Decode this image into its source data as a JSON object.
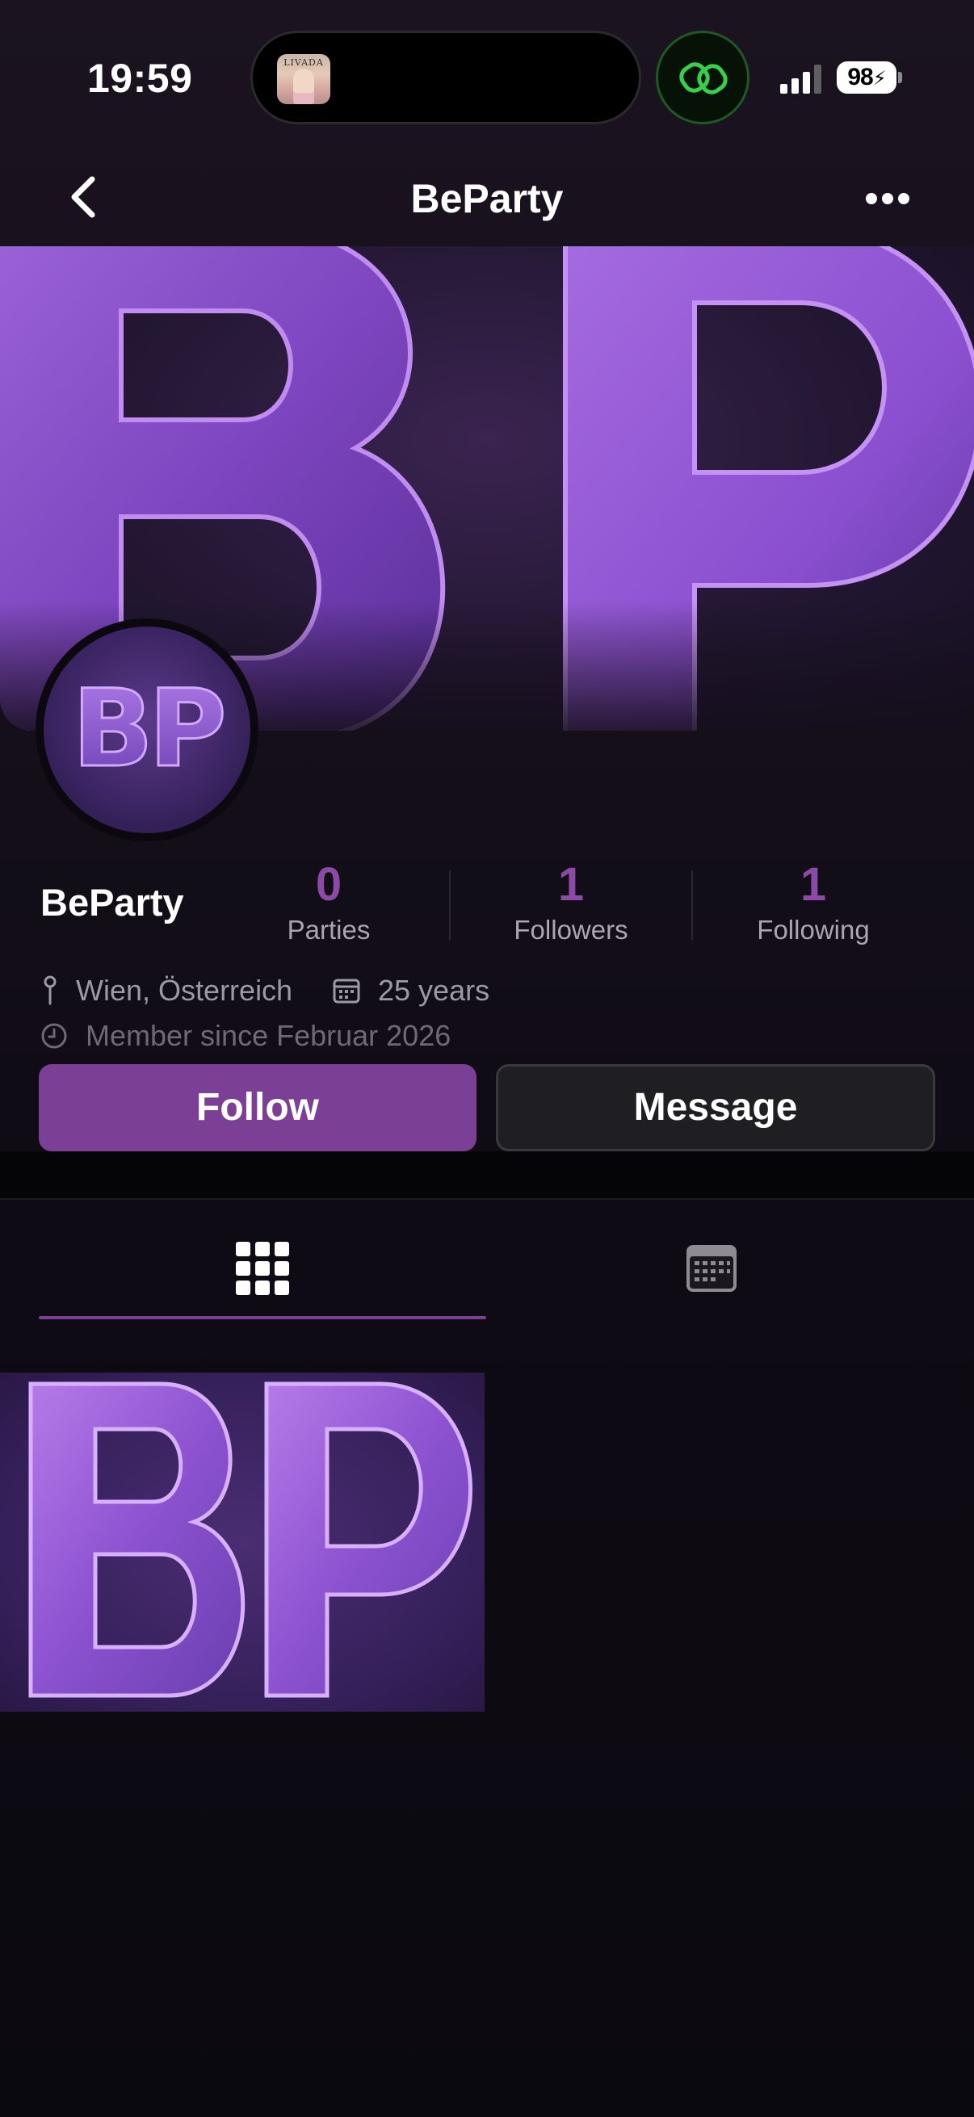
{
  "status_bar": {
    "time": "19:59",
    "island_thumbnail_text": "LIVADA",
    "battery": "98"
  },
  "nav": {
    "title": "BeParty",
    "back_icon": "chevron-left-icon",
    "more_icon": "ellipsis-icon"
  },
  "cover": {
    "logo_text": "BP"
  },
  "avatar": {
    "logo_text": "BP"
  },
  "profile": {
    "name": "BeParty",
    "stats": [
      {
        "value": "0",
        "label": "Parties"
      },
      {
        "value": "1",
        "label": "Followers"
      },
      {
        "value": "1",
        "label": "Following"
      }
    ],
    "location": "Wien, Österreich",
    "age": "25 years",
    "member_since": "Member since Februar 2026"
  },
  "actions": {
    "follow_label": "Follow",
    "message_label": "Message"
  },
  "tabs": [
    {
      "icon": "grid-icon",
      "active": true
    },
    {
      "icon": "calendar-icon",
      "active": false
    }
  ],
  "posts": [
    {
      "logo_text": "BP"
    }
  ],
  "colors": {
    "accent": "#7b3f96",
    "stat_value": "#8a4aa6",
    "background": "#140f19",
    "secondary_button": "#1f1e22"
  }
}
